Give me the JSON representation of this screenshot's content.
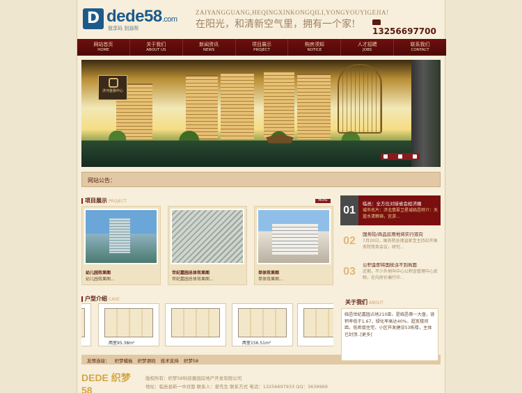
{
  "header": {
    "logo_main": "dede",
    "logo_num": "58",
    "logo_suffix": ".com",
    "logo_sub": "我享码  到源帮",
    "tagline_en": "ZAIYANGGUANG,HEQINGXINKONGQILI,YONGYOUYIGEJIA!",
    "tagline_cn": "在阳光，和清新空气里，拥有一个家!",
    "phone": "13256697700"
  },
  "nav": [
    {
      "cn": "网站首页",
      "en": "HOME"
    },
    {
      "cn": "关于我们",
      "en": "ABOUT US"
    },
    {
      "cn": "新闻资讯",
      "en": "NEWS"
    },
    {
      "cn": "项目展示",
      "en": "PROJECT"
    },
    {
      "cn": "购房须知",
      "en": "NOTICE"
    },
    {
      "cn": "人才招聘",
      "en": "JOBS"
    },
    {
      "cn": "联系我们",
      "en": "CONTACT"
    }
  ],
  "banner": {
    "badge": "济河金融中心"
  },
  "notice": {
    "label": "网站公告："
  },
  "projects_section": {
    "title": "项目展示",
    "title_en": "PROJECT",
    "more": "MORE"
  },
  "projects": [
    {
      "title": "幼儿园效果图",
      "desc": "幼儿园效果图..."
    },
    {
      "title": "世纪嘉园总体效果图",
      "desc": "世纪嘉园总体效果图..."
    },
    {
      "title": "单体效果图",
      "desc": "单体效果图..."
    }
  ],
  "news": [
    {
      "num": "01",
      "title": "临邑：全方位对接省会经济圈",
      "summary": "城市名片：济北翡翠卫星城临邑特介：天蓝水清赖锦，宜游..."
    },
    {
      "num": "02",
      "title": "国务院/商品房用地将实行双向",
      "summary": "7月20日，国务院总理温家宝主持召开国务院常务会议，研究..."
    },
    {
      "num": "03",
      "title": "公积金即将国统派不到局面",
      "summary": "近期，不少外地叫中心公积金管理中心反映，在向房价偏行中..."
    }
  ],
  "house_section": {
    "title": "户型介绍",
    "title_en": "CASE"
  },
  "houses": [
    {
      "caption": ""
    },
    {
      "caption": "两室95.38m²"
    },
    {
      "caption": ""
    },
    {
      "caption": "两室156.51m²"
    },
    {
      "caption": ""
    }
  ],
  "about": {
    "title": "关于我们",
    "title_en": "ABOUT",
    "body": "临邑世纪嘉园占地210亩，是临邑第一大盘，容积率低于1.67，绿化率高达40%，超宽楼间距。低密度住宅，小区开发建设53栋楼，主体已封顶..[更多]"
  },
  "links": {
    "label": "友情连接：",
    "items": [
      "织梦模板",
      "织梦源码",
      "技术支持",
      "织梦58"
    ]
  },
  "footer": {
    "logo": "DEDE 织梦58",
    "copyright": "版权所有：织梦58科技嘉园房地产开发有限公司",
    "address": "地址：临邑县新一中对面 联系人：姜先生 联系方式 电话：13256697933 QQ：3639969"
  }
}
